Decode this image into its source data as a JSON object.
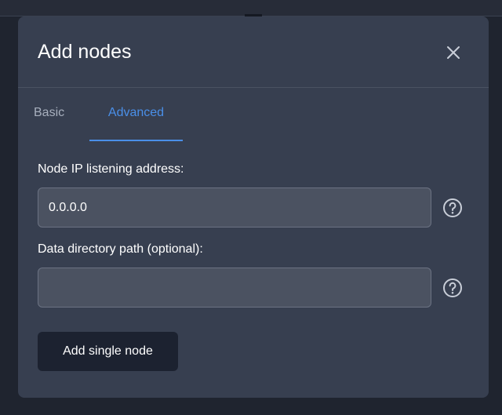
{
  "modal": {
    "title": "Add nodes",
    "close_icon": "close-icon"
  },
  "tabs": [
    {
      "label": "Basic",
      "active": false
    },
    {
      "label": "Advanced",
      "active": true
    }
  ],
  "form": {
    "ip_field": {
      "label": "Node IP listening address:",
      "value": "0.0.0.0",
      "help_icon": "question-circle-icon"
    },
    "dir_field": {
      "label": "Data directory path (optional):",
      "value": "",
      "placeholder": "",
      "help_icon": "question-circle-icon"
    },
    "submit_label": "Add single node"
  },
  "colors": {
    "modal_bg": "#373f50",
    "accent": "#4a8fe8",
    "button_bg": "#1c2230",
    "input_bg": "#4b5261"
  }
}
